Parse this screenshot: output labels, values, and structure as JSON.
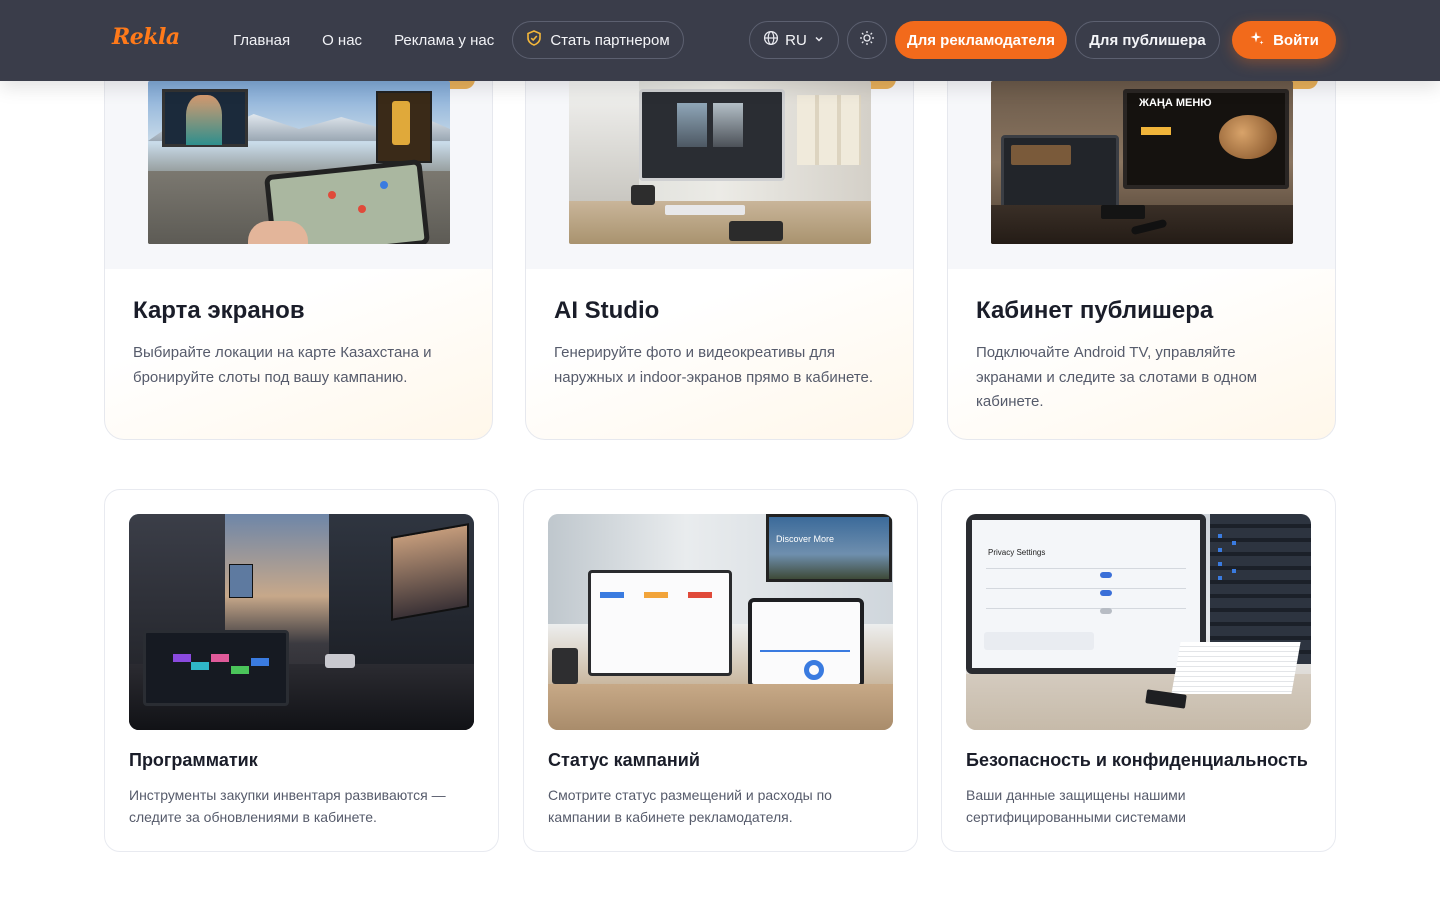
{
  "header": {
    "logo": "Rekla",
    "nav": [
      "Главная",
      "О нас",
      "Реклама у нас"
    ],
    "partner_button": "Стать партнером",
    "language": "RU",
    "advertiser_button": "Для рекламодателя",
    "publisher_button": "Для публишера",
    "login_button": "Войти"
  },
  "top_cards": [
    {
      "title": "Карта экранов",
      "description": "Выбирайте локации на карте Казахстана и бронируйте слоты под вашу кампанию."
    },
    {
      "title": "AI Studio",
      "description": "Генерируйте фото и видеокреативы для наружных и indoor-экранов прямо в кабинете."
    },
    {
      "title": "Кабинет публишера",
      "description": "Подключайте Android TV, управляйте экранами и следите за слотами в одном кабинете.",
      "image_text": [
        "ЖАҢА МЕНЮ"
      ]
    }
  ],
  "bottom_cards": [
    {
      "title": "Программатик",
      "description": "Инструменты закупки инвентаря развиваются — следите за обновлениями в кабинете."
    },
    {
      "title": "Статус кампаний",
      "description": "Смотрите статус размещений и расходы по кампании в кабинете рекламодателя.",
      "image_text": [
        "Discover More"
      ]
    },
    {
      "title": "Безопасность и конфиденциальность",
      "description": "Ваши данные защищены нашими сертифицированными системами",
      "image_text": [
        "Privacy Settings"
      ]
    }
  ],
  "colors": {
    "header_bg": "#3a3d4a",
    "accent_orange": "#f26a1b",
    "logo_orange": "#ff7a1a"
  },
  "icons": [
    "partner-badge-icon",
    "globe-icon",
    "chevron-down-icon",
    "sun-icon",
    "sparkle-icon"
  ]
}
